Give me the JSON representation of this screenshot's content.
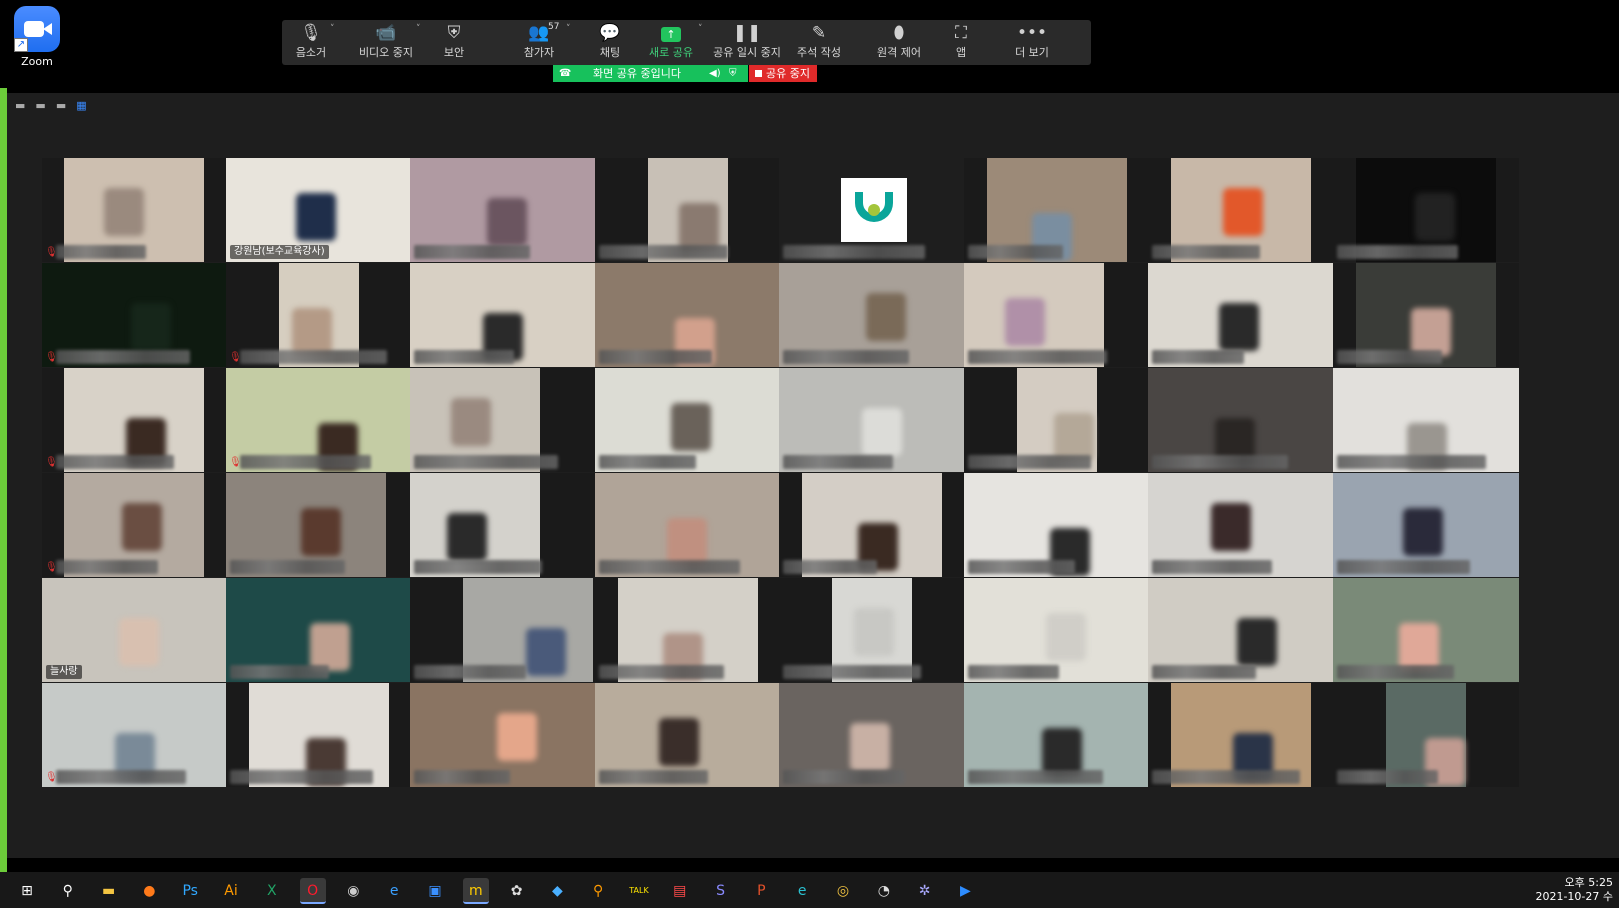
{
  "desktop": {
    "shortcut_label": "Zoom",
    "shortcut_icon": "zoom-app-icon"
  },
  "toolbar": {
    "buttons": [
      {
        "label": "음소거",
        "icon": "microphone-icon",
        "glyph": "🎙"
      },
      {
        "label": "비디오 중지",
        "icon": "video-camera-icon",
        "glyph": "📹"
      },
      {
        "label": "보안",
        "icon": "shield-icon",
        "glyph": "⛨"
      },
      {
        "label": "참가자",
        "icon": "participants-icon",
        "glyph": "👥"
      },
      {
        "label": "채팅",
        "icon": "chat-bubble-icon",
        "glyph": "💬"
      },
      {
        "label": "새로 공유",
        "icon": "share-arrow-icon",
        "glyph": "↑"
      },
      {
        "label": "공유 일시 중지",
        "icon": "pause-icon",
        "glyph": "❚❚"
      },
      {
        "label": "주석 작성",
        "icon": "pen-icon",
        "glyph": "✎"
      },
      {
        "label": "원격 제어",
        "icon": "mouse-icon",
        "glyph": "⬮"
      },
      {
        "label": "앱",
        "icon": "apps-icon",
        "glyph": "⛶"
      },
      {
        "label": "더 보기",
        "icon": "more-dots-icon",
        "glyph": "•••"
      }
    ],
    "participant_count": "57",
    "caret": "˅"
  },
  "share_bar": {
    "status": "화면 공유 중입니다",
    "stop_label": "공유 중지"
  },
  "gallery": {
    "view_controls": [
      "▬",
      "▬",
      "▬",
      "▦"
    ],
    "tiles": [
      {
        "name": "",
        "muted": true,
        "bg": "#cdbfb0",
        "face": "#9a8a7e"
      },
      {
        "name": "강원남(보수교육강사)",
        "muted": false,
        "bg": "#e8e4dc",
        "face": "#1f2e4a"
      },
      {
        "name": "",
        "muted": false,
        "bg": "#b09aa2",
        "face": "#6b5560"
      },
      {
        "name": "",
        "muted": false,
        "bg": "#c8c0b6",
        "face": "#8a7a70"
      },
      {
        "name": "",
        "muted": false,
        "bg": "#1e1e1e",
        "face": "#1e1e1e",
        "logo": true
      },
      {
        "name": "",
        "muted": false,
        "bg": "#9c8a78",
        "face": "#7a8ea0"
      },
      {
        "name": "",
        "muted": false,
        "bg": "#c8b8a8",
        "face": "#e2582a"
      },
      {
        "name": "",
        "muted": false,
        "bg": "#0c0c0c",
        "face": "#222222"
      },
      {
        "name": "",
        "muted": true,
        "bg": "#0e1a10",
        "face": "#16261a"
      },
      {
        "name": "",
        "muted": true,
        "bg": "#d6cec0",
        "face": "#b49a86"
      },
      {
        "name": "",
        "muted": false,
        "bg": "#d8d0c4",
        "face": "#2a2a2a"
      },
      {
        "name": "",
        "muted": false,
        "bg": "#8c7a6a",
        "face": "#d2a08c"
      },
      {
        "name": "",
        "muted": false,
        "bg": "#a8a098",
        "face": "#7a6a58"
      },
      {
        "name": "",
        "muted": false,
        "bg": "#d4cabe",
        "face": "#b090a8"
      },
      {
        "name": "",
        "muted": false,
        "bg": "#dcd8d0",
        "face": "#2a2a2a"
      },
      {
        "name": "",
        "muted": false,
        "bg": "#3a3c38",
        "face": "#c4a094"
      },
      {
        "name": "",
        "muted": true,
        "bg": "#d8d2c8",
        "face": "#3a2a22"
      },
      {
        "name": "",
        "muted": true,
        "bg": "#c4cca4",
        "face": "#3a2a22"
      },
      {
        "name": "",
        "muted": false,
        "bg": "#c8c2b8",
        "face": "#9a8a80"
      },
      {
        "name": "",
        "muted": false,
        "bg": "#dcdcd4",
        "face": "#6a625a"
      },
      {
        "name": "",
        "muted": false,
        "bg": "#bcbcb8",
        "face": "#dcdcd8"
      },
      {
        "name": "",
        "muted": false,
        "bg": "#d4ccc2",
        "face": "#b4a898"
      },
      {
        "name": "",
        "muted": false,
        "bg": "#4a4644",
        "face": "#2a2624"
      },
      {
        "name": "",
        "muted": false,
        "bg": "#e2e0dc",
        "face": "#9a9690"
      },
      {
        "name": "",
        "muted": true,
        "bg": "#b4aaa0",
        "face": "#6a4e42"
      },
      {
        "name": "",
        "muted": false,
        "bg": "#8c847c",
        "face": "#5a3a2e"
      },
      {
        "name": "",
        "muted": false,
        "bg": "#d4d2cc",
        "face": "#2a2a2a"
      },
      {
        "name": "",
        "muted": false,
        "bg": "#b0a498",
        "face": "#c09080"
      },
      {
        "name": "",
        "muted": false,
        "bg": "#d4cec6",
        "face": "#3a2a22"
      },
      {
        "name": "",
        "muted": false,
        "bg": "#e6e4e0",
        "face": "#2a2a2a"
      },
      {
        "name": "",
        "muted": false,
        "bg": "#d6d4d0",
        "face": "#3a2a2a"
      },
      {
        "name": "",
        "muted": false,
        "bg": "#9aa4b0",
        "face": "#2a2a3a"
      },
      {
        "name": "늘사랑",
        "muted": false,
        "bg": "#c8c4bc",
        "face": "#d8c0b0"
      },
      {
        "name": "",
        "muted": false,
        "bg": "#1e4a48",
        "face": "#c0a090"
      },
      {
        "name": "",
        "muted": false,
        "bg": "#a8a8a4",
        "face": "#4a5a7a"
      },
      {
        "name": "",
        "muted": false,
        "bg": "#d4d0c8",
        "face": "#b09488"
      },
      {
        "name": "",
        "muted": false,
        "bg": "#d8d8d4",
        "face": "#c8c8c4"
      },
      {
        "name": "",
        "muted": false,
        "bg": "#e2e0d8",
        "face": "#d0cec8"
      },
      {
        "name": "",
        "muted": false,
        "bg": "#d0ccc4",
        "face": "#2a2a2a"
      },
      {
        "name": "",
        "muted": false,
        "bg": "#7a8a78",
        "face": "#e0a898"
      },
      {
        "name": "",
        "muted": true,
        "bg": "#c6cac8",
        "face": "#7a8a98"
      },
      {
        "name": "",
        "muted": false,
        "bg": "#e0dcd6",
        "face": "#4a3a34"
      },
      {
        "name": "",
        "muted": false,
        "bg": "#8a7462",
        "face": "#e4a68a"
      },
      {
        "name": "",
        "muted": false,
        "bg": "#b8ac9c",
        "face": "#3a2e2a"
      },
      {
        "name": "",
        "muted": false,
        "bg": "#6a6460",
        "face": "#c8b0a4"
      },
      {
        "name": "",
        "muted": false,
        "bg": "#a4b4b0",
        "face": "#2a2a2a"
      },
      {
        "name": "",
        "muted": false,
        "bg": "#b89a78",
        "face": "#2a3448"
      },
      {
        "name": "",
        "muted": false,
        "bg": "#5a6a64",
        "face": "#c09a90"
      }
    ]
  },
  "taskbar": {
    "apps": [
      {
        "icon": "windows-start-icon",
        "glyph": "⊞",
        "color": "#ffffff"
      },
      {
        "icon": "search-icon",
        "glyph": "⚲",
        "color": "#ffffff"
      },
      {
        "icon": "file-explorer-icon",
        "glyph": "▬",
        "color": "#f4c542"
      },
      {
        "icon": "firefox-icon",
        "glyph": "●",
        "color": "#ff7a1a"
      },
      {
        "icon": "photoshop-icon",
        "glyph": "Ps",
        "color": "#31a8ff"
      },
      {
        "icon": "illustrator-icon",
        "glyph": "Ai",
        "color": "#ff9a00"
      },
      {
        "icon": "excel-icon",
        "glyph": "X",
        "color": "#21a366"
      },
      {
        "icon": "opera-icon",
        "glyph": "O",
        "color": "#ff1b2d"
      },
      {
        "icon": "camera-app-icon",
        "glyph": "◉",
        "color": "#cccccc"
      },
      {
        "icon": "internet-explorer-icon",
        "glyph": "e",
        "color": "#3aa0ff"
      },
      {
        "icon": "security-app-icon",
        "glyph": "▣",
        "color": "#3a90ff"
      },
      {
        "icon": "kakao-app-icon",
        "glyph": "m",
        "color": "#ffcc00"
      },
      {
        "icon": "settings-app-icon",
        "glyph": "✿",
        "color": "#dddddd"
      },
      {
        "icon": "bird-app-icon",
        "glyph": "◆",
        "color": "#4ab0ff"
      },
      {
        "icon": "search-app-icon",
        "glyph": "⚲",
        "color": "#ff9a00"
      },
      {
        "icon": "kakaotalk-icon",
        "glyph": "TALK",
        "color": "#ffe600"
      },
      {
        "icon": "document-app-icon",
        "glyph": "▤",
        "color": "#ff4a4a"
      },
      {
        "icon": "s-app-icon",
        "glyph": "S",
        "color": "#8a8aff"
      },
      {
        "icon": "powerpoint-icon",
        "glyph": "P",
        "color": "#e2502a"
      },
      {
        "icon": "edge-icon",
        "glyph": "e",
        "color": "#2ac0d0"
      },
      {
        "icon": "chrome-icon",
        "glyph": "◎",
        "color": "#f4c542"
      },
      {
        "icon": "clock-badge-icon",
        "glyph": "◔",
        "color": "#dddddd"
      },
      {
        "icon": "gear-app-icon",
        "glyph": "✲",
        "color": "#aaaaff"
      },
      {
        "icon": "zoom-taskbar-icon",
        "glyph": "▶",
        "color": "#2d8cff"
      }
    ],
    "clock_time": "오후 5:25",
    "clock_date": "2021-10-27 수"
  }
}
